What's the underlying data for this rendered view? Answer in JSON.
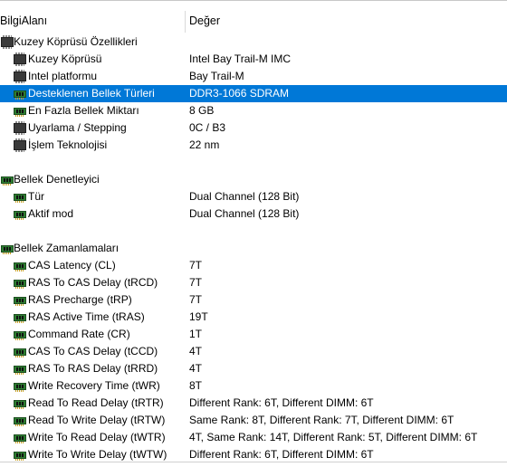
{
  "header": {
    "field_col": "BilgiAlanı",
    "value_col": "Değer"
  },
  "rows": [
    {
      "level": 0,
      "icon": "chip-icon",
      "label": "Kuzey Köprüsü Özellikleri",
      "value": ""
    },
    {
      "level": 1,
      "icon": "chip-icon",
      "label": "Kuzey Köprüsü",
      "value": "Intel Bay Trail-M IMC"
    },
    {
      "level": 1,
      "icon": "chip-icon",
      "label": "Intel platformu",
      "value": "Bay Trail-M"
    },
    {
      "level": 1,
      "icon": "ram-icon",
      "label": "Desteklenen Bellek Türleri",
      "value": "DDR3-1066 SDRAM",
      "selected": true
    },
    {
      "level": 1,
      "icon": "ram-icon",
      "label": "En Fazla Bellek Miktarı",
      "value": "8 GB"
    },
    {
      "level": 1,
      "icon": "chip-icon",
      "label": "Uyarlama / Stepping",
      "value": "0C / B3"
    },
    {
      "level": 1,
      "icon": "chip-icon",
      "label": "İşlem Teknolojisi",
      "value": "22 nm"
    },
    {
      "level": -1,
      "icon": "",
      "label": "",
      "value": ""
    },
    {
      "level": 0,
      "icon": "ram-icon",
      "label": "Bellek Denetleyici",
      "value": ""
    },
    {
      "level": 1,
      "icon": "ram-icon",
      "label": "Tür",
      "value": "Dual Channel  (128 Bit)"
    },
    {
      "level": 1,
      "icon": "ram-icon",
      "label": "Aktif mod",
      "value": "Dual Channel  (128 Bit)"
    },
    {
      "level": -1,
      "icon": "",
      "label": "",
      "value": ""
    },
    {
      "level": 0,
      "icon": "ram-icon",
      "label": "Bellek Zamanlamaları",
      "value": ""
    },
    {
      "level": 1,
      "icon": "ram-icon",
      "label": "CAS Latency (CL)",
      "value": "7T"
    },
    {
      "level": 1,
      "icon": "ram-icon",
      "label": "RAS To CAS Delay (tRCD)",
      "value": "7T"
    },
    {
      "level": 1,
      "icon": "ram-icon",
      "label": "RAS Precharge (tRP)",
      "value": "7T"
    },
    {
      "level": 1,
      "icon": "ram-icon",
      "label": "RAS Active Time (tRAS)",
      "value": "19T"
    },
    {
      "level": 1,
      "icon": "ram-icon",
      "label": "Command Rate (CR)",
      "value": "1T"
    },
    {
      "level": 1,
      "icon": "ram-icon",
      "label": "CAS To CAS Delay (tCCD)",
      "value": "4T"
    },
    {
      "level": 1,
      "icon": "ram-icon",
      "label": "RAS To RAS Delay (tRRD)",
      "value": "4T"
    },
    {
      "level": 1,
      "icon": "ram-icon",
      "label": "Write Recovery Time (tWR)",
      "value": "8T"
    },
    {
      "level": 1,
      "icon": "ram-icon",
      "label": "Read To Read Delay (tRTR)",
      "value": "Different Rank: 6T, Different DIMM: 6T"
    },
    {
      "level": 1,
      "icon": "ram-icon",
      "label": "Read To Write Delay (tRTW)",
      "value": "Same Rank: 8T, Different Rank: 7T, Different DIMM: 6T"
    },
    {
      "level": 1,
      "icon": "ram-icon",
      "label": "Write To Read Delay (tWTR)",
      "value": "4T, Same Rank: 14T, Different Rank: 5T, Different DIMM: 6T"
    },
    {
      "level": 1,
      "icon": "ram-icon",
      "label": "Write To Write Delay (tWTW)",
      "value": "Different Rank: 6T, Different DIMM: 6T"
    }
  ]
}
